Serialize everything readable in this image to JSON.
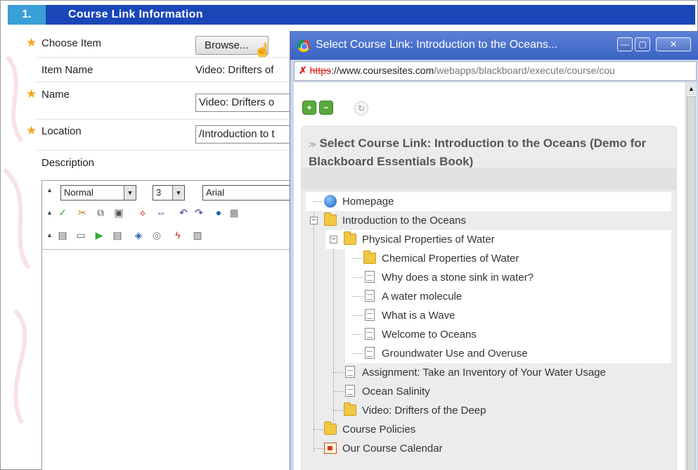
{
  "section": {
    "number": "1.",
    "title": "Course Link Information"
  },
  "form": {
    "choose_item_label": "Choose Item",
    "browse_label": "Browse...",
    "item_name_label": "Item Name",
    "item_name_value": "Video: Drifters of",
    "name_label": "Name",
    "name_value": "Video: Drifters o",
    "location_label": "Location",
    "location_value": "/Introduction to t",
    "description_label": "Description"
  },
  "editor": {
    "format_value": "Normal",
    "size_value": "3",
    "font_value": "Arial"
  },
  "popup": {
    "title": "Select Course Link: Introduction to the Oceans...",
    "url_scheme": "https",
    "url_host": "://www.coursesites.com",
    "url_path": "/webapps/blackboard/execute/course/cou",
    "panel_title": "Select Course Link: Introduction to the Oceans (Demo for Blackboard Essentials Book)",
    "tree": [
      {
        "label": "Homepage",
        "icon": "globe-icon"
      },
      {
        "label": "Introduction to the Oceans",
        "icon": "folder-icon"
      },
      {
        "label": "Physical Properties of Water",
        "icon": "folder-icon"
      },
      {
        "label": "Chemical Properties of Water",
        "icon": "folder-icon"
      },
      {
        "label": "Why does a stone sink in water?",
        "icon": "document-icon"
      },
      {
        "label": "A water molecule",
        "icon": "document-icon"
      },
      {
        "label": "What is a Wave",
        "icon": "document-icon"
      },
      {
        "label": "Welcome to Oceans",
        "icon": "document-icon"
      },
      {
        "label": "Groundwater Use and Overuse",
        "icon": "document-icon"
      },
      {
        "label": "Assignment: Take an Inventory of Your Water Usage",
        "icon": "document-icon"
      },
      {
        "label": "Ocean Salinity",
        "icon": "document-icon"
      },
      {
        "label": "Video: Drifters of the Deep",
        "icon": "folder-icon"
      },
      {
        "label": "Course Policies",
        "icon": "folder-icon"
      },
      {
        "label": "Our Course Calendar",
        "icon": "calendar-icon"
      }
    ]
  },
  "colors": {
    "header_blue": "#1a47b8",
    "number_blue": "#3a9fd6",
    "required_star": "#f7a219",
    "titlebar_blue": "#4466c0"
  }
}
